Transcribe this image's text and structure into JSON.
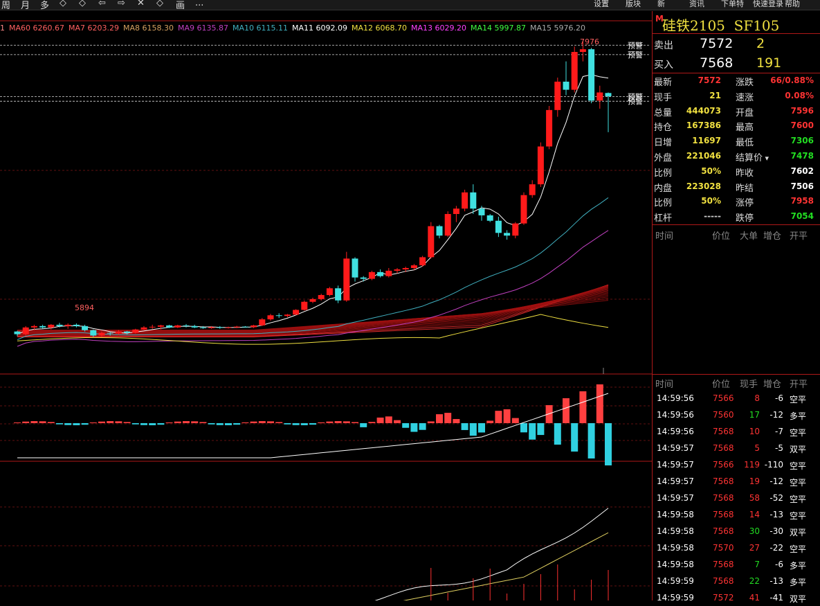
{
  "toolbar": {
    "items": [
      {
        "icon": "period-icon",
        "label": "周"
      },
      {
        "icon": "month-icon",
        "label": "月"
      },
      {
        "icon": "multi-icon",
        "label": "多"
      },
      {
        "icon": "zoom-in-icon",
        "label": "◇"
      },
      {
        "icon": "zoom-out-icon",
        "label": "◇"
      },
      {
        "icon": "back-icon",
        "label": "⇦"
      },
      {
        "icon": "forward-icon",
        "label": "⇨"
      },
      {
        "icon": "cross-icon",
        "label": "✕"
      },
      {
        "icon": "diamond-icon",
        "label": "◇"
      },
      {
        "icon": "draw-icon",
        "label": "画"
      },
      {
        "icon": "more-icon",
        "label": "..."
      }
    ],
    "right_items": [
      "设置",
      "版块",
      "新",
      "资讯",
      "下单特",
      "快速登录",
      "帮助"
    ]
  },
  "ma_legend": [
    {
      "label": "1",
      "color": "#ff8888"
    },
    {
      "label": "MA60 6260.67",
      "color": "#ff6060"
    },
    {
      "label": "MA7 6203.29",
      "color": "#ff6060"
    },
    {
      "label": "MA8 6158.30",
      "color": "#d4a060"
    },
    {
      "label": "MA9 6135.87",
      "color": "#c040c0"
    },
    {
      "label": "MA10 6115.11",
      "color": "#40b0c0"
    },
    {
      "label": "MA11 6092.09",
      "color": "#ffffff"
    },
    {
      "label": "MA12 6068.70",
      "color": "#f0e040"
    },
    {
      "label": "MA13 6029.20",
      "color": "#ff40ff"
    },
    {
      "label": "MA14 5997.87",
      "color": "#40ff40"
    },
    {
      "label": "MA15 5976.20",
      "color": "#aaaaaa"
    }
  ],
  "chart_labels": {
    "high_marker": "7976",
    "low_marker": "5894",
    "alert": "预警"
  },
  "instrument": {
    "marker": "M",
    "name": "硅铁2105",
    "code": "SF105"
  },
  "order_book": {
    "sell": {
      "label": "卖出",
      "price": "7572",
      "volume": "2"
    },
    "buy": {
      "label": "买入",
      "price": "7568",
      "volume": "191"
    }
  },
  "quotes": [
    {
      "l": "最新",
      "lv": "7572",
      "lc": "c-red",
      "r": "涨跌",
      "rv": "66/0.88%",
      "rc": "c-red"
    },
    {
      "l": "现手",
      "lv": "21",
      "lc": "c-yel",
      "r": "速涨",
      "rv": "0.08%",
      "rc": "c-red"
    },
    {
      "l": "总量",
      "lv": "444073",
      "lc": "c-yel",
      "r": "开盘",
      "rv": "7596",
      "rc": "c-red"
    },
    {
      "l": "持仓",
      "lv": "167386",
      "lc": "c-yel",
      "r": "最高",
      "rv": "7600",
      "rc": "c-red"
    },
    {
      "l": "日增",
      "lv": "11697",
      "lc": "c-yel",
      "r": "最低",
      "rv": "7306",
      "rc": "c-grn"
    },
    {
      "l": "外盘",
      "lv": "221046",
      "lc": "c-yel",
      "r": "结算价",
      "rv": "7478",
      "rc": "c-grn"
    },
    {
      "l": "比例",
      "lv": "50%",
      "lc": "c-yel",
      "r": "昨收",
      "rv": "7602",
      "rc": "c-wht"
    },
    {
      "l": "内盘",
      "lv": "223028",
      "lc": "c-yel",
      "r": "昨结",
      "rv": "7506",
      "rc": "c-wht"
    },
    {
      "l": "比例",
      "lv": "50%",
      "lc": "c-yel",
      "r": "涨停",
      "rv": "7958",
      "rc": "c-red"
    },
    {
      "l": "杠杆",
      "lv": "-----",
      "lc": "c-gry",
      "r": "跌停",
      "rv": "7054",
      "rc": "c-grn"
    }
  ],
  "big_order_header": [
    "时间",
    "价位",
    "大单",
    "增仓",
    "开平"
  ],
  "tick_header": [
    "时间",
    "价位",
    "现手",
    "增仓",
    "开平"
  ],
  "ticks": [
    {
      "t": "14:59:56",
      "p": "7566",
      "v": "8",
      "vc": "c-red",
      "d": "-6",
      "k": "空平"
    },
    {
      "t": "14:59:56",
      "p": "7560",
      "v": "17",
      "vc": "c-grn",
      "d": "-12",
      "k": "多平"
    },
    {
      "t": "14:59:56",
      "p": "7568",
      "v": "10",
      "vc": "c-red",
      "d": "-7",
      "k": "空平"
    },
    {
      "t": "14:59:57",
      "p": "7568",
      "v": "5",
      "vc": "c-red",
      "d": "-5",
      "k": "双平"
    },
    {
      "t": "14:59:57",
      "p": "7566",
      "v": "119",
      "vc": "c-red",
      "d": "-110",
      "k": "空平"
    },
    {
      "t": "14:59:57",
      "p": "7568",
      "v": "19",
      "vc": "c-red",
      "d": "-12",
      "k": "空平"
    },
    {
      "t": "14:59:57",
      "p": "7568",
      "v": "58",
      "vc": "c-red",
      "d": "-52",
      "k": "空平"
    },
    {
      "t": "14:59:58",
      "p": "7568",
      "v": "14",
      "vc": "c-red",
      "d": "-13",
      "k": "空平"
    },
    {
      "t": "14:59:58",
      "p": "7568",
      "v": "30",
      "vc": "c-grn",
      "d": "-30",
      "k": "双平"
    },
    {
      "t": "14:59:58",
      "p": "7570",
      "v": "27",
      "vc": "c-red",
      "d": "-22",
      "k": "空平"
    },
    {
      "t": "14:59:58",
      "p": "7568",
      "v": "7",
      "vc": "c-grn",
      "d": "-6",
      "k": "多平"
    },
    {
      "t": "14:59:59",
      "p": "7568",
      "v": "22",
      "vc": "c-grn",
      "d": "-13",
      "k": "多平"
    },
    {
      "t": "14:59:59",
      "p": "7572",
      "v": "41",
      "vc": "c-red",
      "d": "-41",
      "k": "双平"
    }
  ],
  "chart_data": {
    "type": "candlestick",
    "ylim": [
      5700,
      8100
    ],
    "alert_levels": [
      7950,
      7880,
      7570,
      7535
    ],
    "candles": [
      [
        5830,
        5835,
        5795,
        5810
      ],
      [
        5810,
        5870,
        5800,
        5860
      ],
      [
        5860,
        5880,
        5840,
        5870
      ],
      [
        5870,
        5880,
        5850,
        5860
      ],
      [
        5860,
        5885,
        5845,
        5880
      ],
      [
        5880,
        5894,
        5860,
        5870
      ],
      [
        5870,
        5890,
        5850,
        5880
      ],
      [
        5880,
        5890,
        5860,
        5870
      ],
      [
        5870,
        5880,
        5830,
        5840
      ],
      [
        5840,
        5845,
        5790,
        5800
      ],
      [
        5800,
        5830,
        5790,
        5820
      ],
      [
        5820,
        5825,
        5800,
        5815
      ],
      [
        5815,
        5840,
        5805,
        5830
      ],
      [
        5830,
        5835,
        5810,
        5820
      ],
      [
        5820,
        5850,
        5815,
        5845
      ],
      [
        5845,
        5870,
        5840,
        5860
      ],
      [
        5860,
        5880,
        5850,
        5865
      ],
      [
        5865,
        5880,
        5845,
        5875
      ],
      [
        5875,
        5880,
        5855,
        5860
      ],
      [
        5860,
        5880,
        5855,
        5875
      ],
      [
        5875,
        5885,
        5860,
        5870
      ],
      [
        5870,
        5880,
        5855,
        5860
      ],
      [
        5860,
        5870,
        5850,
        5855
      ],
      [
        5855,
        5870,
        5850,
        5862
      ],
      [
        5862,
        5870,
        5850,
        5858
      ],
      [
        5858,
        5866,
        5852,
        5860
      ],
      [
        5860,
        5872,
        5855,
        5866
      ],
      [
        5866,
        5870,
        5860,
        5862
      ],
      [
        5862,
        5880,
        5855,
        5875
      ],
      [
        5875,
        5930,
        5870,
        5920
      ],
      [
        5920,
        5960,
        5910,
        5950
      ],
      [
        5950,
        5965,
        5930,
        5945
      ],
      [
        5945,
        5960,
        5935,
        5955
      ],
      [
        5955,
        5995,
        5950,
        5990
      ],
      [
        5990,
        6060,
        5985,
        6050
      ],
      [
        6050,
        6080,
        6040,
        6070
      ],
      [
        6070,
        6110,
        6060,
        6100
      ],
      [
        6100,
        6160,
        6090,
        6150
      ],
      [
        6150,
        6170,
        6040,
        6060
      ],
      [
        6060,
        6420,
        6050,
        6370
      ],
      [
        6370,
        6380,
        6200,
        6230
      ],
      [
        6230,
        6240,
        6200,
        6220
      ],
      [
        6220,
        6280,
        6210,
        6270
      ],
      [
        6270,
        6290,
        6230,
        6240
      ],
      [
        6240,
        6300,
        6230,
        6280
      ],
      [
        6280,
        6300,
        6260,
        6290
      ],
      [
        6290,
        6310,
        6270,
        6300
      ],
      [
        6300,
        6330,
        6285,
        6320
      ],
      [
        6320,
        6390,
        6310,
        6380
      ],
      [
        6380,
        6640,
        6370,
        6610
      ],
      [
        6610,
        6620,
        6520,
        6540
      ],
      [
        6540,
        6720,
        6530,
        6700
      ],
      [
        6700,
        6760,
        6640,
        6740
      ],
      [
        6740,
        6880,
        6720,
        6860
      ],
      [
        6860,
        6920,
        6700,
        6740
      ],
      [
        6740,
        6760,
        6650,
        6690
      ],
      [
        6690,
        6700,
        6640,
        6650
      ],
      [
        6650,
        6680,
        6530,
        6560
      ],
      [
        6560,
        6580,
        6510,
        6540
      ],
      [
        6540,
        6640,
        6520,
        6630
      ],
      [
        6630,
        6860,
        6620,
        6840
      ],
      [
        6840,
        6950,
        6820,
        6920
      ],
      [
        6920,
        7230,
        6900,
        7200
      ],
      [
        7200,
        7500,
        7180,
        7470
      ],
      [
        7470,
        7710,
        7420,
        7680
      ],
      [
        7680,
        7830,
        7580,
        7620
      ],
      [
        7620,
        7940,
        7600,
        7900
      ],
      [
        7900,
        7976,
        7830,
        7920
      ],
      [
        7920,
        7930,
        7520,
        7540
      ],
      [
        7540,
        7650,
        7480,
        7600
      ],
      [
        7596,
        7600,
        7306,
        7572
      ]
    ]
  }
}
